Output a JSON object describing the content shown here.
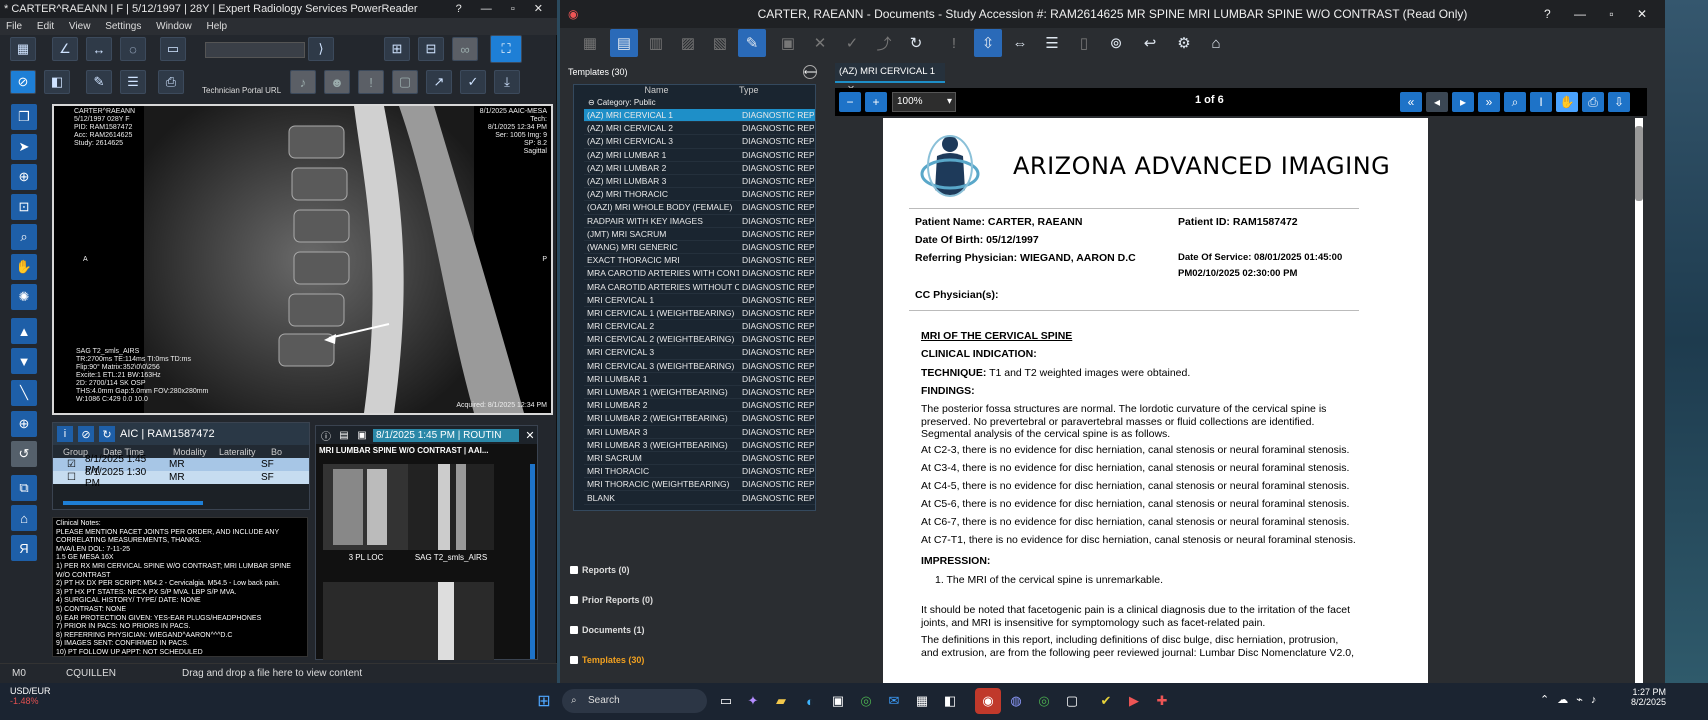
{
  "left_app": {
    "title": "* CARTER^RAEANN | F | 5/12/1997 | 28Y | Expert Radiology Services PowerReader",
    "menu": [
      "File",
      "Edit",
      "View",
      "Settings",
      "Window",
      "Help"
    ],
    "technician_portal": "Technician Portal URL",
    "viewer": {
      "overlay_tl": "CARTER^RAEANN\n5/12/1997 028Y F\nPID: RAM1587472\nAcc: RAM2614625\nStudy: 2614625",
      "overlay_tr": "8/1/2025 AAIC-MESA\nTech:\n8/1/2025 12:34 PM\nSer: 1005 Img: 9\nSP: 8.2\nSagittal",
      "overlay_bl": "SAG T2_smls_AIRS\nTR:2700ms TE:114ms TI:0ms TD:ms\nFlip:90° Matrix:352\\0\\0\\256\nExcite:1 ETL:21 BW:163Hz\n2D: 2700/114 SK OSP\nTHS:4.0mm Gap:5.0mm FOV:280x280mm\nW:1086 C:429 0.0 10.0",
      "overlay_br": "Acquired: 8/1/2025 12:34 PM",
      "orient_left": "A",
      "orient_right": "P"
    },
    "patient_panel": {
      "title": "AIC | RAM1587472",
      "columns": [
        "Group",
        "Date Time",
        "Modality",
        "Laterality",
        "Bo"
      ],
      "rows": [
        {
          "date": "8/1/2025 1:45 PM",
          "modality": "MR",
          "bo": "SF"
        },
        {
          "date": "8/1/2025 1:30 PM",
          "modality": "MR",
          "bo": "SF"
        }
      ]
    },
    "notes": "Clinical Notes:\nPLEASE MENTION FACET JOINTS PER ORDER, AND INCLUDE ANY\nCORRELATING MEASUREMENTS, THANKS.\nMVA/LEN DOL: 7-11-25\n1.5 GE MESA 16X\n1) PER RX MRI CERVICAL SPINE W/O CONTRAST; MRI LUMBAR SPINE\nW/O CONTRAST\n2) PT HX DX PER SCRIPT: M54.2 - Cervicalgia. M54.5 - Low back pain.\n3) PT HX PT STATES: NECK PX S/P MVA. LBP S/P MVA.\n4) SURGICAL HISTORY/ TYPE/ DATE: NONE\n5) CONTRAST: NONE\n6) EAR PROTECTION GIVEN: YES-EAR PLUGS/HEADPHONES\n7) PRIOR IN PACS: NO PRIORS IN PACS.\n8) REFERRING PHYSICIAN: WIEGAND^AARON^^^D.C\n9) IMAGES SENT: CONFIRMED IN PACS.\n10) PT FOLLOW UP APPT: NOT SCHEDULED",
    "series_panel": {
      "tab": "8/1/2025 1:45 PM | ROUTIN",
      "study": "MRI LUMBAR SPINE W/O CONTRAST | AAI...",
      "thumbs": [
        "3 PL LOC",
        "SAG T2_smls_AIRS"
      ]
    },
    "status": {
      "m0": "M0",
      "user": "CQUILLEN",
      "hint": "Drag and drop a file here to view content"
    }
  },
  "right_app": {
    "title": "CARTER, RAEANN - Documents - Study Accession #: RAM2614625 MR SPINE MRI LUMBAR SPINE W/O CONTRAST (Read Only)",
    "templates_header": "Templates (30)",
    "tpl_columns": [
      "Name",
      "Type"
    ],
    "category": "Category: Public",
    "templates": [
      "(AZ) MRI CERVICAL 1",
      "(AZ) MRI CERVICAL 2",
      "(AZ) MRI CERVICAL 3",
      "(AZ) MRI LUMBAR 1",
      "(AZ) MRI LUMBAR 2",
      "(AZ) MRI LUMBAR 3",
      "(AZ) MRI THORACIC",
      "(OAZI) MRI WHOLE BODY (FEMALE)",
      "RADPAIR WITH KEY IMAGES",
      "(JMT) MRI SACRUM",
      "(WANG) MRI GENERIC",
      "EXACT THORACIC MRI",
      "MRA CAROTID ARTERIES WITH CONTRA...",
      "MRA CAROTID ARTERIES WITHOUT CON...",
      "MRI CERVICAL 1",
      "MRI CERVICAL 1 (WEIGHTBEARING)",
      "MRI CERVICAL 2",
      "MRI CERVICAL 2 (WEIGHTBEARING)",
      "MRI CERVICAL 3",
      "MRI CERVICAL 3 (WEIGHTBEARING)",
      "MRI LUMBAR 1",
      "MRI LUMBAR 1 (WEIGHTBEARING)",
      "MRI LUMBAR 2",
      "MRI LUMBAR 2 (WEIGHTBEARING)",
      "MRI LUMBAR 3",
      "MRI LUMBAR 3 (WEIGHTBEARING)",
      "MRI SACRUM",
      "MRI THORACIC",
      "MRI THORACIC (WEIGHTBEARING)",
      "BLANK"
    ],
    "template_type": "DIAGNOSTIC REP...",
    "accordion": [
      "Reports (0)",
      "Prior Reports (0)",
      "Documents (1)",
      "Templates (30)"
    ],
    "doc_tab": "(AZ) MRI CERVICAL 1",
    "zoom": "100%",
    "page": "1 of 6",
    "report": {
      "brand": "ARIZONA ADVANCED IMAGING",
      "patient_name": "Patient Name: CARTER, RAEANN",
      "patient_id": "Patient ID:  RAM1587472",
      "dob": "Date Of Birth:  05/12/1997",
      "referring": "Referring Physician: WIEGAND, AARON D.C",
      "dos": "Date  Of  Service:  08/01/2025  01:45:00",
      "dos2": "PM02/10/2025 02:30:00 PM",
      "cc": "CC Physician(s):",
      "heading": "MRI OF THE CERVICAL SPINE",
      "clinical": "CLINICAL INDICATION:",
      "technique_label": "TECHNIQUE:",
      "technique": " T1 and T2 weighted images were obtained.",
      "findings": "FINDINGS:",
      "finding_para": "The posterior fossa structures are normal. The lordotic curvature of the cervical spine is preserved. No prevertebral or paravertebral masses or fluid collections are identified. Segmental analysis of the cervical spine is as follows.",
      "levels": [
        "At C2-3, there is no evidence for disc herniation, canal stenosis or neural foraminal stenosis.",
        "At C3-4, there is no evidence for disc herniation, canal stenosis or neural foraminal stenosis.",
        "At C4-5, there is no evidence for disc herniation, canal stenosis or neural foraminal stenosis.",
        "At C5-6, there is no evidence for disc herniation, canal stenosis or neural foraminal stenosis.",
        "At C6-7, there is no evidence for disc herniation, canal stenosis or neural foraminal stenosis.",
        "At C7-T1, there is no evidence for disc herniation, canal stenosis or neural foraminal stenosis."
      ],
      "impression": "IMPRESSION:",
      "impression_item": "1.   The MRI of the cervical spine is unremarkable.",
      "note1": "It should be noted that facetogenic pain is a clinical diagnosis due to the irritation of the facet joints, and MRI is insensitive for symptomology such as facet-related pain.",
      "note2": "The definitions in this report, including definitions of disc bulge, disc herniation, protrusion, and extrusion, are from the following peer reviewed journal: Lumbar Disc Nomenclature V2.0,"
    }
  },
  "taskbar": {
    "currency": "USD/EUR",
    "change": "-1.48%",
    "search": "Search",
    "time": "1:27 PM",
    "date": "8/2/2025"
  }
}
